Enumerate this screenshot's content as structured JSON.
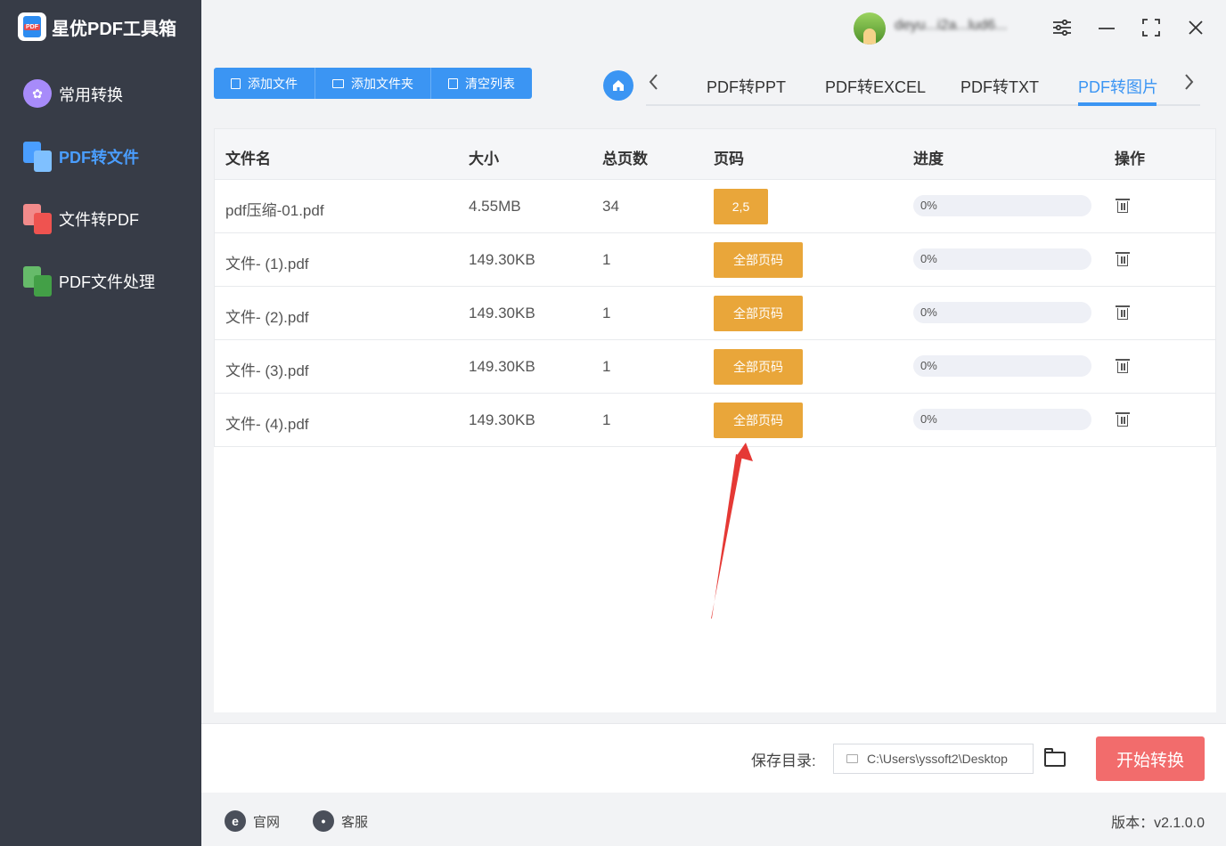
{
  "app": {
    "title": "星优PDF工具箱"
  },
  "sidebar": {
    "items": [
      {
        "label": "常用转换",
        "active": false,
        "icon": "apps-icon",
        "color": "#a78bfa"
      },
      {
        "label": "PDF转文件",
        "active": true,
        "icon": "pdf-to-file-icon",
        "color": "#4a9eff"
      },
      {
        "label": "文件转PDF",
        "active": false,
        "icon": "file-to-pdf-icon",
        "color": "#ef5350"
      },
      {
        "label": "PDF文件处理",
        "active": false,
        "icon": "pdf-process-icon",
        "color": "#4caf50"
      }
    ]
  },
  "titlebar": {
    "username": "deyu...i2a...lud6..."
  },
  "toolbar": {
    "add_file": "添加文件",
    "add_folder": "添加文件夹",
    "clear_list": "清空列表"
  },
  "tabs": {
    "items": [
      "PDF转PPT",
      "PDF转EXCEL",
      "PDF转TXT",
      "PDF转图片"
    ],
    "active": "PDF转图片"
  },
  "table": {
    "headers": [
      "文件名",
      "大小",
      "总页数",
      "页码",
      "进度",
      "操作"
    ],
    "rows": [
      {
        "name": "pdf压缩-01.pdf",
        "size": "4.55MB",
        "pages": "34",
        "page_range": "2,5",
        "progress": 0,
        "progress_text": "0%"
      },
      {
        "name": "文件- (1).pdf",
        "size": "149.30KB",
        "pages": "1",
        "page_range": "全部页码",
        "progress": 0,
        "progress_text": "0%"
      },
      {
        "name": "文件- (2).pdf",
        "size": "149.30KB",
        "pages": "1",
        "page_range": "全部页码",
        "progress": 0,
        "progress_text": "0%"
      },
      {
        "name": "文件- (3).pdf",
        "size": "149.30KB",
        "pages": "1",
        "page_range": "全部页码",
        "progress": 0,
        "progress_text": "0%"
      },
      {
        "name": "文件- (4).pdf",
        "size": "149.30KB",
        "pages": "1",
        "page_range": "全部页码",
        "progress": 0,
        "progress_text": "0%"
      }
    ]
  },
  "bottom": {
    "save_label": "保存目录:",
    "save_path": "C:\\Users\\yssoft2\\Desktop",
    "start_button": "开始转换"
  },
  "footer": {
    "website": "官网",
    "support": "客服",
    "version": "版本：v2.1.0.0"
  },
  "colors": {
    "accent": "#3b95f3",
    "page_button": "#e9a63a",
    "start_button": "#f26c6c",
    "sidebar_bg": "#373c47",
    "annotation_arrow": "#e53935"
  }
}
